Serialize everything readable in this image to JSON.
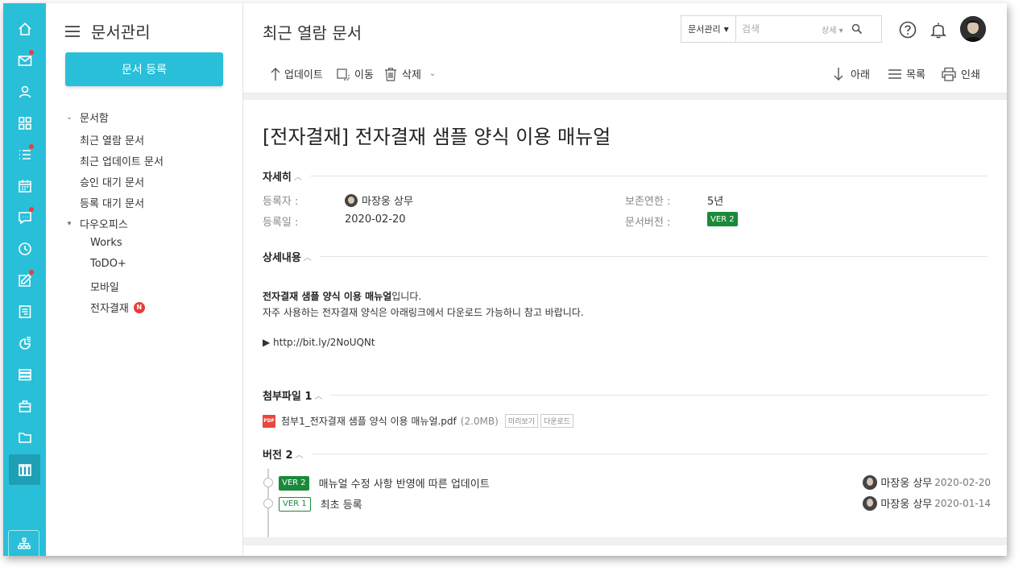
{
  "sidebar": {
    "title": "문서관리",
    "register_button": "문서 등록",
    "tree": [
      {
        "label": "문서함",
        "arrow": "⌄"
      },
      {
        "label": "최근 열람 문서"
      },
      {
        "label": "최근 업데이트 문서"
      },
      {
        "label": "승인 대기 문서"
      },
      {
        "label": "등록 대기 문서"
      },
      {
        "label": "다우오피스",
        "arrow": "▾"
      },
      {
        "label": "Works"
      },
      {
        "label": "ToDO+"
      },
      {
        "label": "모바일"
      },
      {
        "label": "전자결재",
        "badge": "N"
      }
    ]
  },
  "rail": {
    "icons": [
      "home-icon",
      "mail-icon",
      "user-icon",
      "apps-icon",
      "list-icon",
      "calendar-icon",
      "chat-icon",
      "clock-icon",
      "edit-icon",
      "board-icon",
      "report-icon",
      "stack-icon",
      "briefcase-icon",
      "folder-icon",
      "docs-icon"
    ],
    "accent": "#29bfd9"
  },
  "header": {
    "title": "최근 열람 문서",
    "search": {
      "scope": "문서관리",
      "placeholder": "검색",
      "detail": "상세"
    }
  },
  "toolbar": {
    "update": "업데이트",
    "move": "이동",
    "delete": "삭제",
    "down": "아래",
    "list": "목록",
    "print": "인쇄"
  },
  "doc": {
    "title": "[전자결재] 전자결재 샘플 양식 이용 매뉴얼",
    "details_heading": "자세히",
    "registrant_label": "등록자 :",
    "registrant": "마장웅 상무",
    "reg_date_label": "등록일 :",
    "reg_date": "2020-02-20",
    "retention_label": "보존연한 :",
    "retention": "5년",
    "version_label": "문서버전 :",
    "version": "VER 2",
    "content_heading": "상세내용",
    "content_line1_bold": "전자결재 샘플 양식 이용 매뉴얼",
    "content_line1_rest": "입니다.",
    "content_line2": "자주 사용하는 전자결재 양식은 아래링크에서 다운로드 가능하니 참고 바랍니다.",
    "content_link": "▶ http://bit.ly/2NoUQNt",
    "attach_heading": "첨부파일 1",
    "attachment": {
      "name": "첨부1_전자결재 샘플 양식 이용 매뉴얼.pdf",
      "size": "(2.0MB)",
      "preview": "미리보기",
      "download": "다운로드",
      "icon_text": "PDF"
    },
    "versions_heading": "버전 2",
    "versions": [
      {
        "badge": "VER 2",
        "desc": "매뉴얼 수정 사항 반영에 따른 업데이트",
        "author": "마장웅 상무",
        "date": "2020-02-20"
      },
      {
        "badge": "VER 1",
        "desc": "최초 등록",
        "author": "마장웅 상무",
        "date": "2020-01-14"
      }
    ]
  },
  "colors": {
    "version_green": "#1a8a3a",
    "badge_red": "#e63c3c"
  }
}
